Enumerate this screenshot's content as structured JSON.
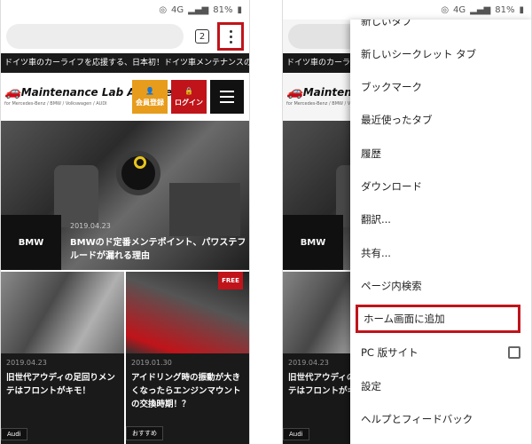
{
  "status": {
    "network": "4G",
    "battery": "81%"
  },
  "toolbar": {
    "tab_count": "2"
  },
  "site": {
    "banner": "ドイツ車のカーライフを応援する、日本初！ドイツ車メンテナンスの情報サイ",
    "logo_main": "Maintenance Lab Archive",
    "logo_sub": "for Mercedes-Benz / BMW / Volkswagen / AUDI",
    "member_label": "会員登録",
    "login_label": "ログイン",
    "hero": {
      "category": "BMW",
      "date": "2019.04.23",
      "title": "BMWのド定番メンテポイント、パワステフルードが漏れる理由"
    },
    "cards": [
      {
        "date": "2019.04.23",
        "title": "旧世代アウディの足回りメンテはフロントがキモ！",
        "tag": "Audi",
        "badge": ""
      },
      {
        "date": "2019.01.30",
        "title": "アイドリング時の振動が大きくなったらエンジンマウントの交換時期！？",
        "tag": "おすすめ",
        "badge": "FREE"
      }
    ]
  },
  "menu": {
    "cut_item": "新しいタブ",
    "items": [
      {
        "label": "新しいシークレット タブ"
      },
      {
        "label": "ブックマーク"
      },
      {
        "label": "最近使ったタブ"
      },
      {
        "label": "履歴"
      },
      {
        "label": "ダウンロード"
      },
      {
        "label": "翻訳..."
      },
      {
        "label": "共有..."
      },
      {
        "label": "ページ内検索"
      },
      {
        "label": "ホーム画面に追加"
      },
      {
        "label": "PC 版サイト"
      },
      {
        "label": "設定"
      },
      {
        "label": "ヘルプとフィードバック"
      }
    ]
  },
  "colors": {
    "accent_red": "#c0141a",
    "member_orange": "#e89c1b"
  }
}
